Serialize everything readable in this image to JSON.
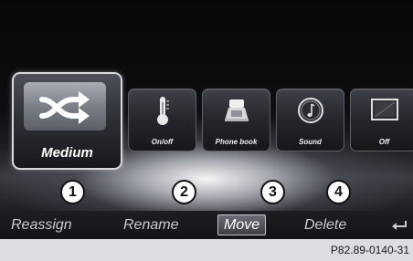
{
  "tiles": {
    "main": {
      "label": "Medium",
      "icon": "shuffle-icon"
    },
    "items": [
      {
        "label": "On/off",
        "icon": "thermometer-icon"
      },
      {
        "label": "Phone book",
        "icon": "phone-book-icon"
      },
      {
        "label": "Sound",
        "icon": "sound-icon"
      },
      {
        "label": "Off",
        "icon": "display-off-icon"
      }
    ]
  },
  "callouts": [
    "1",
    "2",
    "3",
    "4"
  ],
  "menu": {
    "reassign": "Reassign",
    "rename": "Rename",
    "move": "Move",
    "delete": "Delete",
    "back_icon": "back-icon",
    "selected": "Move"
  },
  "footer": {
    "code": "P82.89-0140-31"
  },
  "colors": {
    "background": "#0b0b0d",
    "menubar": "#1d1e22",
    "footer": "#dcdde0",
    "selected_border": "#d7d9dd"
  }
}
